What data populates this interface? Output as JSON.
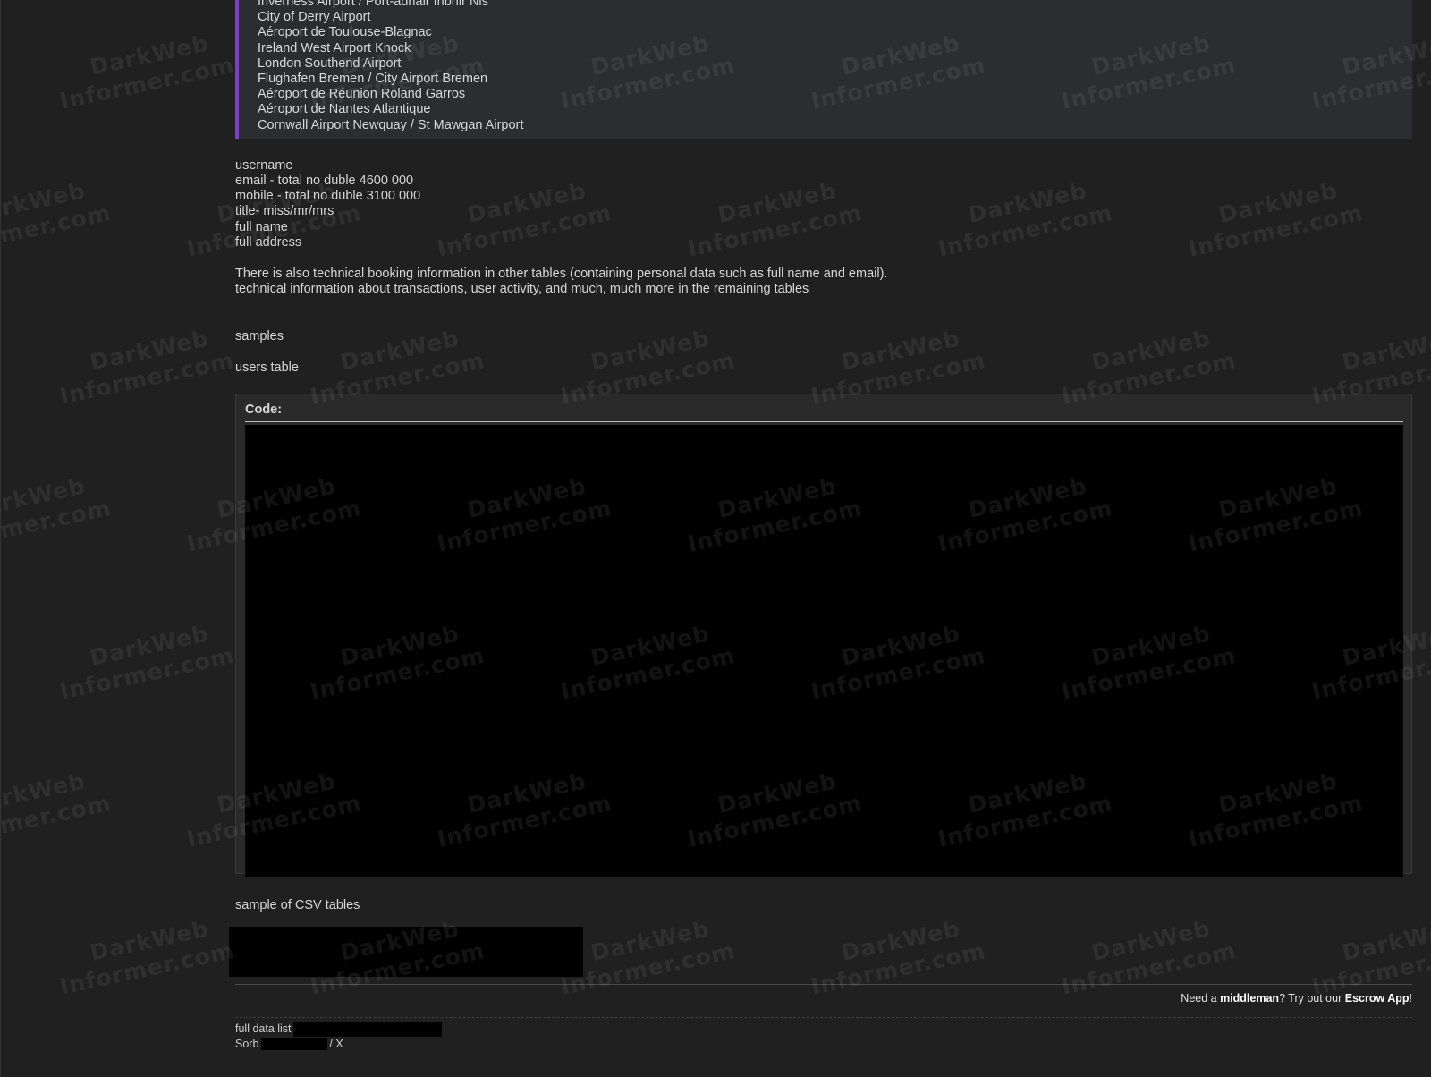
{
  "quote": {
    "airports": [
      "Inverness Airport / Port-adhair Inbhir Nis",
      "City of Derry Airport",
      "Aéroport de Toulouse-Blagnac",
      "Ireland West Airport Knock",
      "London Southend Airport",
      "Flughafen Bremen / City Airport Bremen",
      "Aéroport de Réunion Roland Garros",
      "Aéroport de Nantes Atlantique",
      "Cornwall Airport Newquay / St Mawgan Airport"
    ],
    "accent_color": "#7a3fc4"
  },
  "fields": [
    "username",
    "email - total no duble 4600 000",
    "mobile - total no duble 3100 000",
    "title- miss/mr/mrs",
    "full name",
    "full address"
  ],
  "technical": [
    "There is also technical booking information in other tables (containing personal data such as full name and email).",
    "technical information about transactions, user activity, and much, much more in the remaining tables"
  ],
  "samples_label": "samples",
  "users_table_label": "users table",
  "code_block": {
    "title": "Code:"
  },
  "csv_label": "sample of CSV tables",
  "footer": {
    "promo_prefix": "Need a ",
    "promo_middleman": "middleman",
    "promo_middle": "? Try out our ",
    "promo_escrow": "Escrow App",
    "promo_suffix": "!"
  },
  "signature": {
    "full_data_list": "full data list",
    "sorb": "Sorb",
    "sorb_suffix": "/ X"
  },
  "watermark": {
    "line1": "DarkWeb",
    "line2": "Informer.com"
  }
}
